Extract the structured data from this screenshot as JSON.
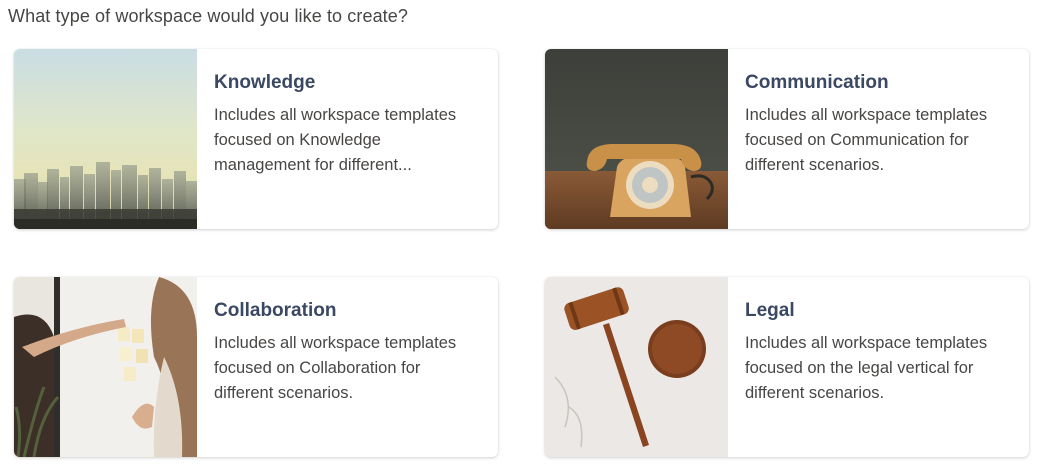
{
  "question": "What type of workspace would you like to create?",
  "cards": [
    {
      "title": "Knowledge",
      "description": "Includes all workspace templates focused on Knowledge management for different...",
      "image": "foggy-city-skyline-image"
    },
    {
      "title": "Communication",
      "description": "Includes all workspace templates focused on Communication for different scenarios.",
      "image": "rotary-telephone-image"
    },
    {
      "title": "Collaboration",
      "description": "Includes all workspace templates focused on Collaboration for different scenarios.",
      "image": "people-at-whiteboard-image"
    },
    {
      "title": "Legal",
      "description": "Includes all workspace templates focused on the legal vertical for different scenarios.",
      "image": "gavel-image"
    }
  ]
}
